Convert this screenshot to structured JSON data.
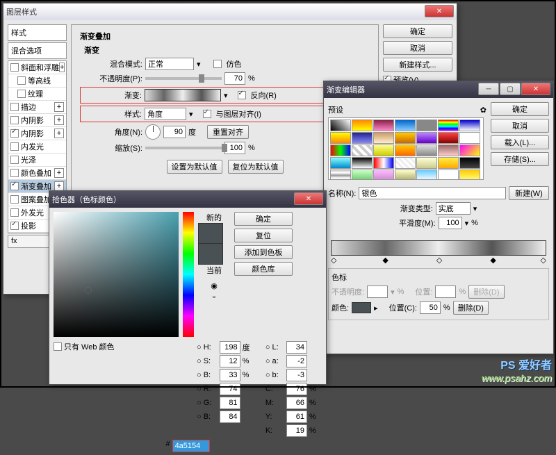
{
  "layerStyle": {
    "title": "图层样式",
    "sidebar": {
      "styles": "样式",
      "blending": "混合选项",
      "items": [
        {
          "label": "斜面和浮雕",
          "c": false,
          "p": true
        },
        {
          "label": "等高线",
          "c": false,
          "p": false,
          "indent": true
        },
        {
          "label": "纹理",
          "c": false,
          "p": false,
          "indent": true
        },
        {
          "label": "描边",
          "c": false,
          "p": true
        },
        {
          "label": "内阴影",
          "c": false,
          "p": true
        },
        {
          "label": "内阴影",
          "c": true,
          "p": true
        },
        {
          "label": "内发光",
          "c": false,
          "p": false
        },
        {
          "label": "光泽",
          "c": false,
          "p": false
        },
        {
          "label": "颜色叠加",
          "c": false,
          "p": true
        },
        {
          "label": "渐变叠加",
          "c": true,
          "p": true,
          "sel": true
        },
        {
          "label": "图案叠加",
          "c": false,
          "p": false
        },
        {
          "label": "外发光",
          "c": false,
          "p": false
        },
        {
          "label": "投影",
          "c": true,
          "p": true
        }
      ],
      "fx": "fx"
    },
    "panel": {
      "heading": "渐变叠加",
      "sub": "渐变",
      "blendMode": {
        "label": "混合模式:",
        "value": "正常",
        "dither": "仿色"
      },
      "opacity": {
        "label": "不透明度(P):",
        "value": "70",
        "pct": "%"
      },
      "gradient": {
        "label": "渐变:",
        "reverse": "反向(R)"
      },
      "style": {
        "label": "样式:",
        "value": "角度",
        "align": "与图层对齐(I)"
      },
      "angle": {
        "label": "角度(N):",
        "value": "90",
        "deg": "度",
        "reset": "重置对齐"
      },
      "scale": {
        "label": "缩放(S):",
        "value": "100",
        "pct": "%"
      },
      "setDefault": "设置为默认值",
      "resetDefault": "复位为默认值"
    },
    "buttons": {
      "ok": "确定",
      "cancel": "取消",
      "newStyle": "新建样式...",
      "preview": "预览(V)"
    }
  },
  "gradEditor": {
    "title": "渐变编辑器",
    "presetsLabel": "预设",
    "gear": "✿",
    "buttons": {
      "ok": "确定",
      "cancel": "取消",
      "load": "载入(L)...",
      "save": "存储(S)..."
    },
    "name": {
      "label": "名称(N):",
      "value": "银色",
      "new": "新建(W)"
    },
    "gradType": {
      "label": "渐变类型:",
      "value": "实底"
    },
    "smooth": {
      "label": "平滑度(M):",
      "value": "100",
      "pct": "%"
    },
    "stops": {
      "title": "色标",
      "opacity": {
        "label": "不透明度:",
        "pct": "%",
        "pos": "位置:",
        "del": "删除(D)"
      },
      "color": {
        "label": "颜色:",
        "pos": "位置(C):",
        "val": "50",
        "pct": "%",
        "del": "删除(D)"
      }
    },
    "presetColors": [
      "linear-gradient(45deg,#000,#fff)",
      "linear-gradient(#f80,#ff0)",
      "linear-gradient(#824,#f8c)",
      "linear-gradient(#06c,#8cf)",
      "#888",
      "linear-gradient(red,#ff0,#0f0,#0ff,#00f,#f0f)",
      "linear-gradient(#00c,#fff)",
      "linear-gradient(#ff0,#f80)",
      "linear-gradient(#228,#88f)",
      "linear-gradient(#c96,#fec)",
      "linear-gradient(#fc0,#c60)",
      "linear-gradient(#b8f,#60c)",
      "linear-gradient(#f44,#800)",
      "#fff",
      "linear-gradient(90deg,red,#0f0,#00f)",
      "repeating-linear-gradient(45deg,#ccc 0 4px,#fff 4px 8px)",
      "linear-gradient(#ff8,#cc0)",
      "linear-gradient(#fc0,#f60)",
      "linear-gradient(#ddd,#888)",
      "linear-gradient(#966,#fcc)",
      "linear-gradient(135deg,#f0f,#ff0)",
      "linear-gradient(#8ff,#08c)",
      "linear-gradient(#000,#fff)",
      "linear-gradient(90deg,#f00,#fff,#00f)",
      "repeating-linear-gradient(45deg,#eee 0 3px,#fff 3px 6px)",
      "linear-gradient(#ffd,#cc8)",
      "linear-gradient(#fe4,#fa0)",
      "linear-gradient(#000,#444)",
      "linear-gradient(#ccc,#fff,#999,#fff,#ccc)",
      "linear-gradient(#cfc,#6c6)",
      "linear-gradient(#fbf,#c8c)",
      "linear-gradient(#ffc,#aa6)",
      "linear-gradient(#6cf,#fff)",
      "#fff",
      "linear-gradient(#fc0,#ff8)",
      "linear-gradient(#ff0,#fc0)"
    ]
  },
  "picker": {
    "title": "拾色器（色标颜色）",
    "new": "新的",
    "current": "当前",
    "buttons": {
      "ok": "确定",
      "reset": "复位",
      "add": "添加到色板",
      "lib": "颜色库"
    },
    "webOnly": "只有 Web 颜色",
    "hex": {
      "prefix": "#",
      "value": "4a5154"
    },
    "hsb": {
      "H": {
        "l": "H:",
        "v": "198",
        "u": "度"
      },
      "S": {
        "l": "S:",
        "v": "12",
        "u": "%"
      },
      "B": {
        "l": "B:",
        "v": "33",
        "u": "%"
      }
    },
    "rgb": {
      "R": {
        "l": "R:",
        "v": "74"
      },
      "G": {
        "l": "G:",
        "v": "81"
      },
      "B": {
        "l": "B:",
        "v": "84"
      }
    },
    "lab": {
      "L": {
        "l": "L:",
        "v": "34"
      },
      "a": {
        "l": "a:",
        "v": "-2"
      },
      "b": {
        "l": "b:",
        "v": "-3"
      }
    },
    "cmyk": {
      "C": {
        "l": "C:",
        "v": "76",
        "u": "%"
      },
      "M": {
        "l": "M:",
        "v": "66",
        "u": "%"
      },
      "Y": {
        "l": "Y:",
        "v": "61",
        "u": "%"
      },
      "K": {
        "l": "K:",
        "v": "19",
        "u": "%"
      }
    },
    "swatchNew": "#4a5154",
    "swatchCur": "#4a5154"
  },
  "watermark": {
    "brand": "PS 爱好者",
    "url": "www.psahz.com"
  }
}
